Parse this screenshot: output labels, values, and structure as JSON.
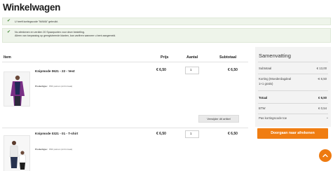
{
  "page": {
    "title": "Winkelwagen"
  },
  "messages": [
    {
      "text": "U heeft kortingscode \"MAMA\" gebruikt."
    },
    {
      "line1": "Nu afrekenen en verdien 20 Spaarpunten voor deze bestelling.",
      "line2": "Alleen van toepassing op geregistreerde klanten, kan variëren wanneer u bent aangemeld."
    }
  ],
  "table": {
    "headers": {
      "item": "Item",
      "price": "Prijs",
      "qty": "Aantal",
      "subtotal": "Subtotaal"
    }
  },
  "items": [
    {
      "name": "Knipmode 0621 - 22 - Vest",
      "type_label": "Producttype:",
      "type_value": "PDF patroon (A4 formaat)",
      "price": "€ 6,50",
      "qty": "1",
      "subtotal": "€ 6,50",
      "remove_label": "Verwijder dit artikel"
    },
    {
      "name": "Knipmode 0321 - 01 - T-shirt",
      "type_label": "Producttype:",
      "type_value": "PDF patroon (A4 formaat)",
      "price": "€ 6,50",
      "qty": "1",
      "subtotal": "€ 6,50"
    }
  ],
  "summary": {
    "title": "Samenvatting",
    "subtotal_label": "Subtotaal",
    "subtotal_value": "€ 13,00",
    "discount_label_1": "Korting (Moederdagdeal",
    "discount_label_2": "1+1 gratis)",
    "discount_value": "-€ 6,50",
    "total_label": "Totaal",
    "total_value": "€ 6,50",
    "vat_label": "BTW",
    "vat_value": "€ 0,54",
    "coupon_label": "Pas kortingscode toe"
  },
  "checkout": {
    "label": "Doorgaan naar afrekenen"
  },
  "colors": {
    "accent": "#f07d12",
    "message_bg": "#eef4ea",
    "check": "#4a8a3c",
    "summary_bg": "#f3f3f3"
  },
  "icons": {
    "check": "check-icon",
    "chevron": "chevron-down-icon",
    "scroll_top": "arrow-up-icon"
  }
}
